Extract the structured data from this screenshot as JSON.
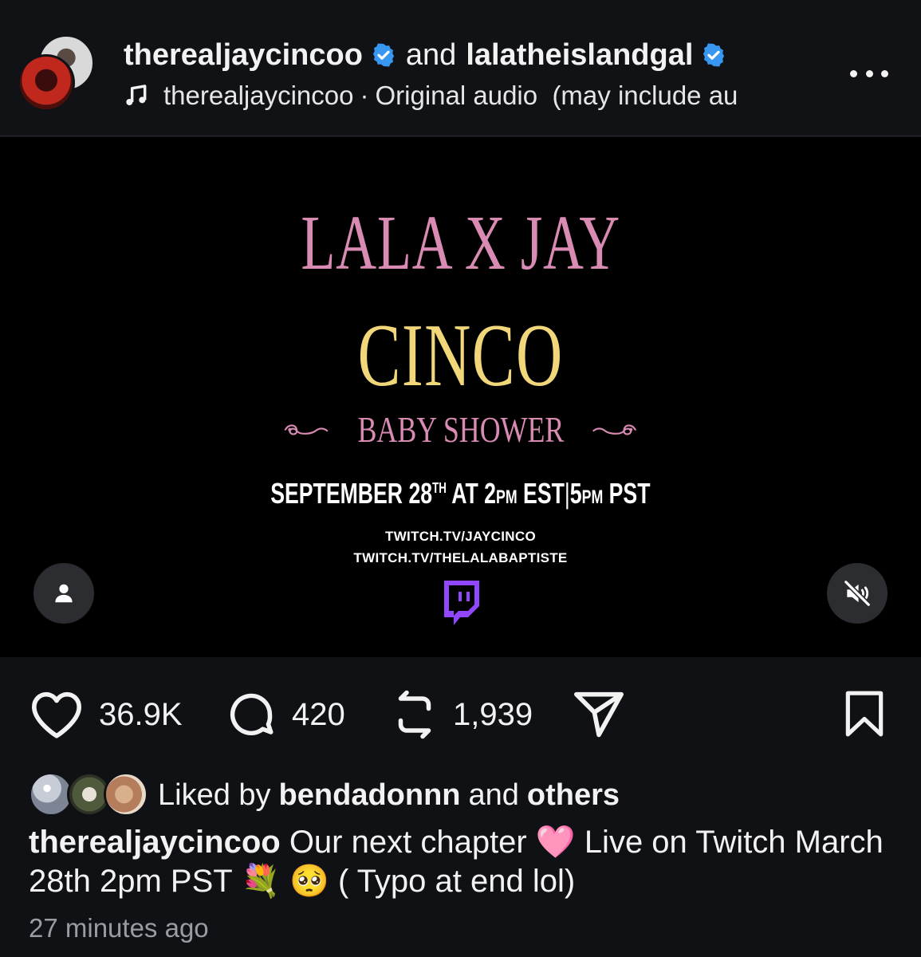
{
  "header": {
    "user1": "therealjaycincoo",
    "and": "and",
    "user2": "lalatheislandgal",
    "audio_user": "therealjaycincoo",
    "audio_sep": "·",
    "audio_title": "Original audio  (may include au",
    "icons": [
      "music-note-icon",
      "verified-badge-icon",
      "more-options-icon"
    ]
  },
  "video": {
    "title_line1": "LALA X JAY",
    "title_line2": "CINCO",
    "subtitle": "BABY SHOWER",
    "date_month": "SEPTEMBER 28",
    "date_suffix": "TH",
    "date_at": "AT 2",
    "date_pm1": "PM",
    "date_est": "EST",
    "date_sep": "|",
    "date_5": "5",
    "date_pm2": "PM",
    "date_pst": "PST",
    "link1": "TWITCH.TV/JAYCINCO",
    "link2": "TWITCH.TV/THELALABAPTISTE",
    "colors": {
      "pink": "#d98bb3",
      "gold": "#f1d77a",
      "twitch": "#9146ff"
    }
  },
  "actions": {
    "likes": "36.9K",
    "comments": "420",
    "reposts": "1,939"
  },
  "liked_by": {
    "prefix": "Liked by",
    "user": "bendadonnn",
    "and": "and",
    "others": "others"
  },
  "caption": {
    "user": "therealjaycincoo",
    "text1": "Our next chapter",
    "emoji1": "🩷",
    "text2": "Live on Twitch March 28th 2pm PST",
    "emoji2": "💐",
    "emoji3": "🥺",
    "text3": "( Typo at end lol)"
  },
  "timestamp": "27 minutes ago"
}
